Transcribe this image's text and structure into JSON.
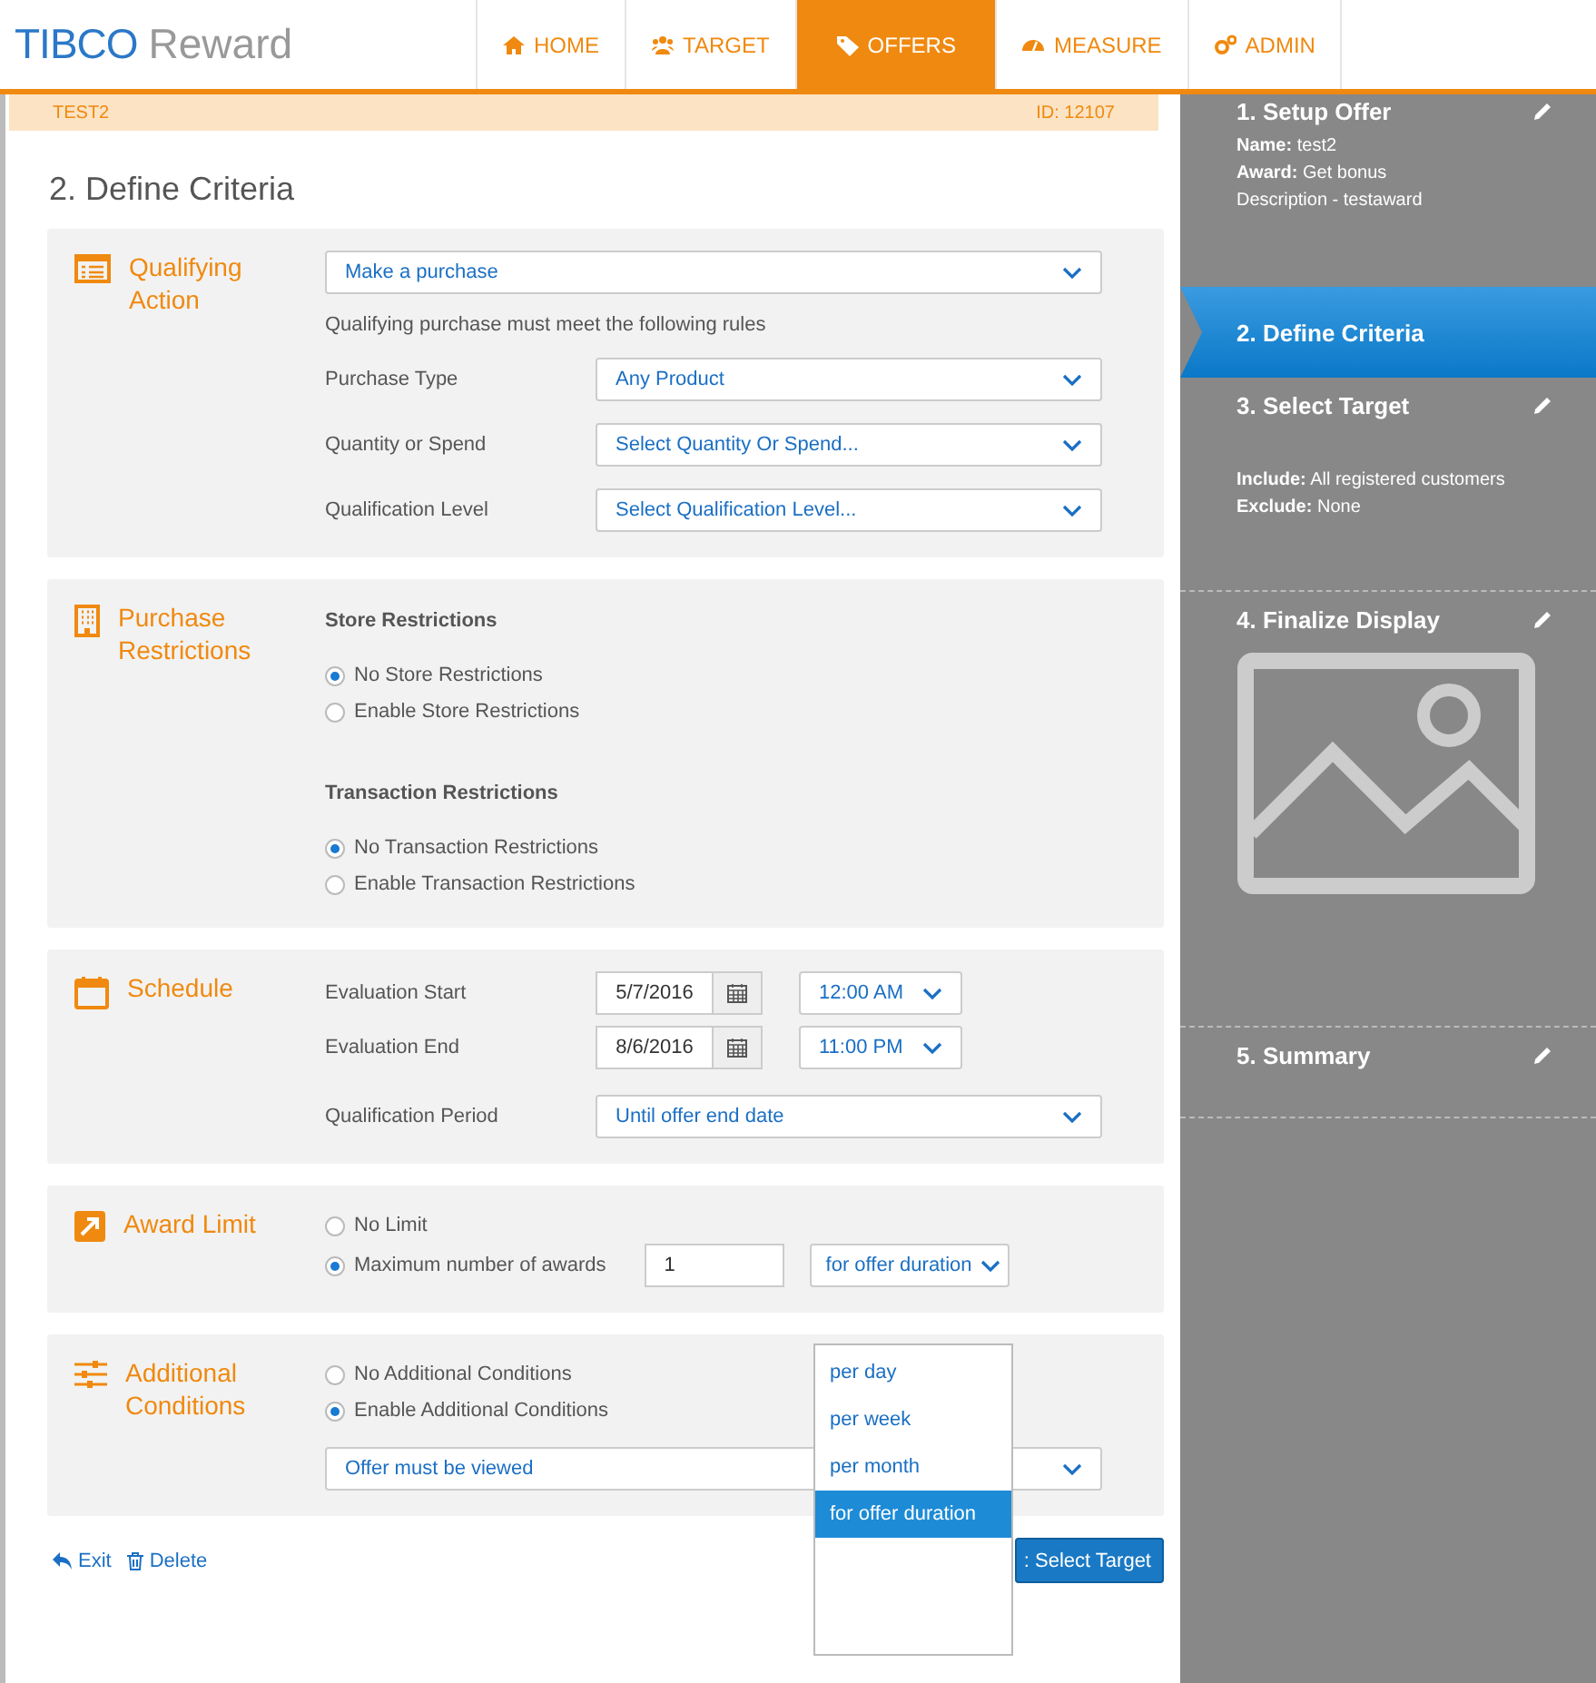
{
  "header": {
    "logo_brand": "TIBCO",
    "logo_product": "Reward",
    "nav": [
      {
        "label": "HOME",
        "selected": false
      },
      {
        "label": "TARGET",
        "selected": false
      },
      {
        "label": "OFFERS",
        "selected": true
      },
      {
        "label": "MEASURE",
        "selected": false
      },
      {
        "label": "ADMIN",
        "selected": false
      }
    ]
  },
  "banner": {
    "name": "TEST2",
    "id": "ID: 12107"
  },
  "page_title": "2. Define Criteria",
  "sections": [
    {
      "kind": "qualifying",
      "title": "Qualifying Action",
      "action": "Make a purchase",
      "note": "Qualifying purchase must meet the following rules",
      "rows": [
        {
          "label": "Purchase Type",
          "value": "Any Product"
        },
        {
          "label": "Quantity or Spend",
          "value": "Select Quantity Or Spend..."
        },
        {
          "label": "Qualification Level",
          "value": "Select Qualification Level..."
        }
      ]
    },
    {
      "kind": "restrictions",
      "title": "Purchase Restrictions",
      "groups": [
        {
          "heading": "Store Restrictions",
          "options": [
            {
              "label": "No Store Restrictions",
              "selected": true
            },
            {
              "label": "Enable Store Restrictions",
              "selected": false
            }
          ]
        },
        {
          "heading": "Transaction Restrictions",
          "options": [
            {
              "label": "No Transaction Restrictions",
              "selected": true
            },
            {
              "label": "Enable Transaction Restrictions",
              "selected": false
            }
          ]
        }
      ]
    },
    {
      "kind": "schedule",
      "title": "Schedule",
      "dates": [
        {
          "label": "Evaluation Start",
          "date": "5/7/2016",
          "time": "12:00 AM"
        },
        {
          "label": "Evaluation End",
          "date": "8/6/2016",
          "time": "11:00 PM"
        }
      ],
      "period": {
        "label": "Qualification Period",
        "value": "Until offer end date"
      }
    },
    {
      "kind": "award_limit",
      "title": "Award Limit",
      "options": [
        {
          "label": "No Limit",
          "selected": false
        },
        {
          "label": "Maximum number of awards",
          "selected": true
        }
      ],
      "max_value": "1",
      "duration": "for offer duration",
      "duration_options": [
        {
          "label": "per day",
          "selected": false
        },
        {
          "label": "per week",
          "selected": false
        },
        {
          "label": "per month",
          "selected": false
        },
        {
          "label": "for offer duration",
          "selected": true
        }
      ]
    },
    {
      "kind": "additional",
      "title": "Additional Conditions",
      "options": [
        {
          "label": "No Additional Conditions",
          "selected": false
        },
        {
          "label": "Enable Additional Conditions",
          "selected": true
        }
      ],
      "condition": "Offer must be viewed"
    }
  ],
  "footer": {
    "exit": "Exit",
    "delete": "Delete",
    "next": ": Select Target"
  },
  "steps": [
    {
      "kind": "details",
      "title": "1. Setup Offer",
      "selected": false,
      "details": [
        {
          "label": "Name:",
          "value": "test2"
        },
        {
          "label": "Award:",
          "value": "Get bonus"
        },
        {
          "value": "Description - testaward"
        }
      ]
    },
    {
      "kind": "plain",
      "title": "2. Define Criteria",
      "selected": true
    },
    {
      "kind": "details",
      "title": "3. Select Target",
      "selected": false,
      "details": [
        {
          "label": "Include:",
          "value": "All registered customers"
        },
        {
          "label": "Exclude:",
          "value": "None"
        }
      ]
    },
    {
      "kind": "image",
      "title": "4. Finalize Display",
      "selected": false
    },
    {
      "kind": "plain",
      "title": "5. Summary",
      "selected": false
    }
  ]
}
